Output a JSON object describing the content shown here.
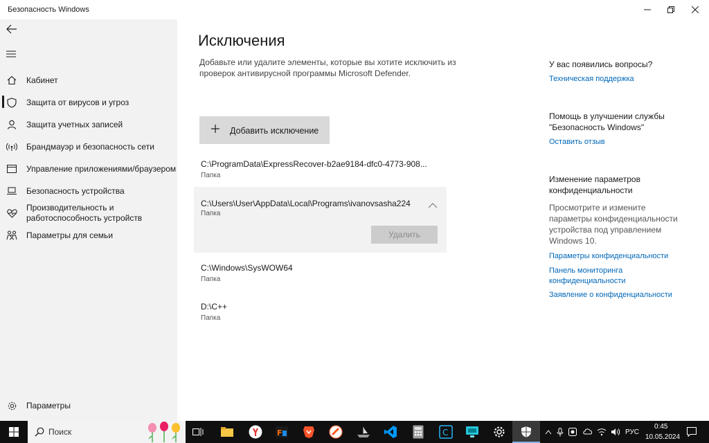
{
  "window": {
    "title": "Безопасность Windows"
  },
  "sidebar": {
    "items": [
      {
        "label": "Кабинет",
        "icon": "home-icon"
      },
      {
        "label": "Защита от вирусов и угроз",
        "icon": "shield-icon",
        "active": true
      },
      {
        "label": "Защита учетных записей",
        "icon": "person-icon"
      },
      {
        "label": "Брандмауэр и безопасность сети",
        "icon": "antenna-icon"
      },
      {
        "label": "Управление приложениями/браузером",
        "icon": "app-window-icon"
      },
      {
        "label": "Безопасность устройства",
        "icon": "laptop-icon"
      },
      {
        "label": "Производительность и работоспособность устройств",
        "icon": "heart-pulse-icon"
      },
      {
        "label": "Параметры для семьи",
        "icon": "family-icon"
      }
    ],
    "settings_label": "Параметры"
  },
  "main": {
    "title": "Исключения",
    "description": "Добавьте или удалите элементы, которые вы хотите исключить из проверок антивирусной программы Microsoft Defender.",
    "add_button_label": "Добавить исключение",
    "exclusions": [
      {
        "path": "C:\\ProgramData\\ExpressRecover-b2ae9184-dfc0-4773-908...",
        "type": "Папка"
      },
      {
        "path": "C:\\Users\\User\\AppData\\Local\\Programs\\ivanovsasha224",
        "type": "Папка",
        "expanded": true
      },
      {
        "path": "C:\\Windows\\SysWOW64",
        "type": "Папка"
      },
      {
        "path": "D:\\C++",
        "type": "Папка"
      }
    ],
    "delete_button_label": "Удалить"
  },
  "right_panel": {
    "questions_heading": "У вас появились вопросы?",
    "support_link": "Техническая поддержка",
    "improve_heading": "Помощь в улучшении службы \"Безопасность Windows\"",
    "feedback_link": "Оставить отзыв",
    "privacy_heading": "Изменение параметров конфиденциальности",
    "privacy_text": "Просмотрите и измените параметры конфиденциальности устройства под управлением Windows 10.",
    "privacy_links": [
      "Параметры конфиденциальности",
      "Панель мониторинга конфиденциальности",
      "Заявление о конфиденциальности"
    ]
  },
  "taskbar": {
    "search_placeholder": "Поиск",
    "language": "РУС",
    "time": "0:45",
    "date": "10.05.2024"
  },
  "colors": {
    "accent_link": "#0067b8",
    "sidebar_bg": "#f2f2f2",
    "taskbar_bg": "#101010"
  }
}
